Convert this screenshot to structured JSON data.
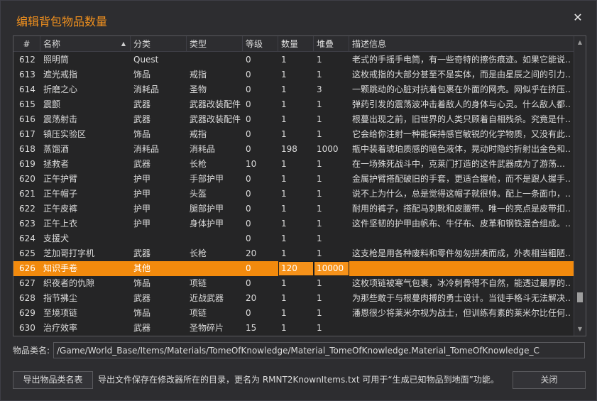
{
  "window": {
    "title": "编辑背包物品数量",
    "close_symbol": "✕"
  },
  "table": {
    "columns": [
      "#",
      "名称",
      "分类",
      "类型",
      "等级",
      "数量",
      "堆叠",
      "描述信息"
    ],
    "sort_column": "名称",
    "sort_direction": "ascending",
    "rows": [
      {
        "id": "612",
        "name": "照明筒",
        "category": "Quest",
        "type": "",
        "level": "0",
        "qty": "1",
        "stack": "1",
        "desc": "老式的手摇手电筒，有一些奇特的擦伤痕迹。如果它能说…"
      },
      {
        "id": "613",
        "name": "遮光戒指",
        "category": "饰品",
        "type": "戒指",
        "level": "0",
        "qty": "1",
        "stack": "1",
        "desc": "这枚戒指的大部分甚至不是实体，而是由星辰之间的引力…"
      },
      {
        "id": "614",
        "name": "折磨之心",
        "category": "消耗品",
        "type": "圣物",
        "level": "0",
        "qty": "1",
        "stack": "3",
        "desc": "一颗跳动的心脏对抗着包裹在外面的网壳。网似乎在挤压…"
      },
      {
        "id": "615",
        "name": "震颤",
        "category": "武器",
        "type": "武器改装配件",
        "level": "0",
        "qty": "1",
        "stack": "1",
        "desc": "弹药引发的震荡波冲击着敌人的身体与心灵。什么敌人都…"
      },
      {
        "id": "616",
        "name": "震荡射击",
        "category": "武器",
        "type": "武器改装配件",
        "level": "0",
        "qty": "1",
        "stack": "1",
        "desc": "根蔓出现之前，旧世界的人类只顾着自相残杀。究竟是什…"
      },
      {
        "id": "617",
        "name": "镇压实验区",
        "category": "饰品",
        "type": "戒指",
        "level": "0",
        "qty": "1",
        "stack": "1",
        "desc": "它会给你注射一种能保持感官敏锐的化学物质，又没有此…"
      },
      {
        "id": "618",
        "name": "蒸馏酒",
        "category": "消耗品",
        "type": "消耗品",
        "level": "0",
        "qty": "198",
        "stack": "1000",
        "desc": "瓶中装着琥珀质感的暗色液体，晃动时隐约折射出金色和…"
      },
      {
        "id": "619",
        "name": "拯救者",
        "category": "武器",
        "type": "长枪",
        "level": "10",
        "qty": "1",
        "stack": "1",
        "desc": "在一场殊死战斗中，克莱门打造的这件武器成为了游荡…"
      },
      {
        "id": "620",
        "name": "正午护臂",
        "category": "护甲",
        "type": "手部护甲",
        "level": "0",
        "qty": "1",
        "stack": "1",
        "desc": "金属护臂搭配破旧的手套，更适合握枪，而不是跟人握手…"
      },
      {
        "id": "621",
        "name": "正午帽子",
        "category": "护甲",
        "type": "头盔",
        "level": "0",
        "qty": "1",
        "stack": "1",
        "desc": "说不上为什么，总是觉得这帽子就很帅。配上一条面巾，…"
      },
      {
        "id": "622",
        "name": "正午皮裤",
        "category": "护甲",
        "type": "腿部护甲",
        "level": "0",
        "qty": "1",
        "stack": "1",
        "desc": "耐用的裤子，搭配马刺靴和皮腰带。唯一的亮点是皮带扣…"
      },
      {
        "id": "623",
        "name": "正午上衣",
        "category": "护甲",
        "type": "身体护甲",
        "level": "0",
        "qty": "1",
        "stack": "1",
        "desc": "这件坚韧的护甲由帆布、牛仔布、皮革和钢铁混合组成。…"
      },
      {
        "id": "624",
        "name": "支援犬",
        "category": "",
        "type": "",
        "level": "0",
        "qty": "1",
        "stack": "1",
        "desc": ""
      },
      {
        "id": "625",
        "name": "芝加哥打字机",
        "category": "武器",
        "type": "长枪",
        "level": "20",
        "qty": "1",
        "stack": "1",
        "desc": "这支枪是用各种废料和零件匆匆拼凑而成，外表相当粗陋…"
      },
      {
        "id": "626",
        "name": "知识手卷",
        "category": "其他",
        "type": "",
        "level": "0",
        "qty": "120",
        "stack": "10000",
        "desc": "",
        "selected": true
      },
      {
        "id": "627",
        "name": "织夜者的仇隙",
        "category": "饰品",
        "type": "项链",
        "level": "0",
        "qty": "1",
        "stack": "1",
        "desc": "这枚项链被寒气包裹，冰冷刺骨得不自然，能透过最厚的…"
      },
      {
        "id": "628",
        "name": "指节拂尘",
        "category": "武器",
        "type": "近战武器",
        "level": "20",
        "qty": "1",
        "stack": "1",
        "desc": "为那些敢于与根蔓肉搏的勇士设计。当徒手格斗无法解决…"
      },
      {
        "id": "629",
        "name": "至境项链",
        "category": "饰品",
        "type": "项链",
        "level": "0",
        "qty": "1",
        "stack": "1",
        "desc": "潘恩很少将莱米尔视为战士，但训练有素的莱米尔比任何…"
      },
      {
        "id": "630",
        "name": "治疗效率",
        "category": "武器",
        "type": "圣物碎片",
        "level": "15",
        "qty": "1",
        "stack": "1",
        "desc": ""
      }
    ]
  },
  "class_name": {
    "label": "物品类名:",
    "value": "/Game/World_Base/Items/Materials/TomeOfKnowledge/Material_TomeOfKnowledge.Material_TomeOfKnowledge_C"
  },
  "footer": {
    "export_label": "导出物品类名表",
    "hint": "导出文件保存在修改器所在的目录，更名为 RMNT2KnownItems.txt 可用于“生成已知物品到地面”功能。",
    "close_label": "关闭"
  },
  "scrollbar": {
    "position": 0.92
  },
  "colors": {
    "accent": "#f28a0d",
    "title": "#f0901e",
    "background": "#2d2d30",
    "grid": "#252526"
  }
}
